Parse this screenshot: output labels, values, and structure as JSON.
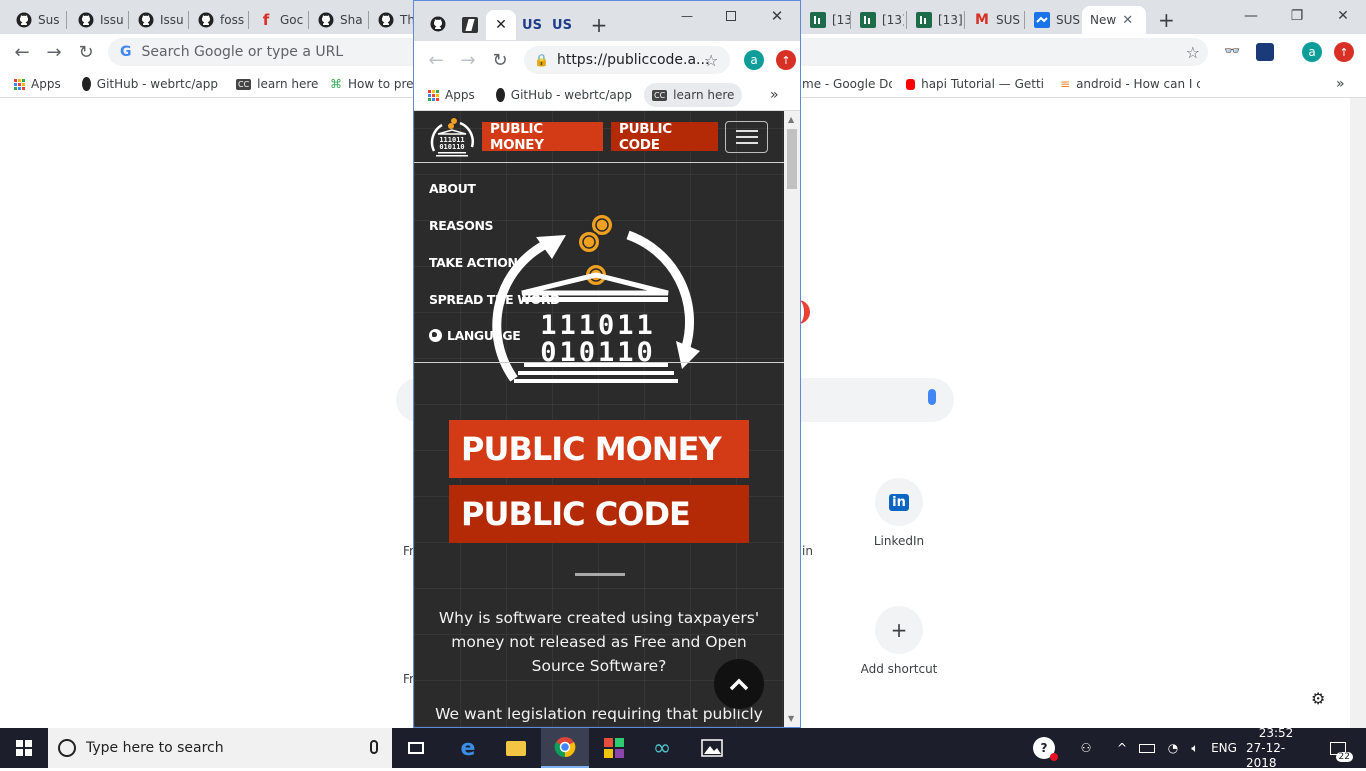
{
  "colors": {
    "accent_red": "#d23b16",
    "accent_red_dark": "#b52a06",
    "orange_coin": "#f0a020"
  },
  "background_window": {
    "tabs": [
      {
        "label": "Sus",
        "icon": "github-icon"
      },
      {
        "label": "Issu",
        "icon": "github-icon"
      },
      {
        "label": "Issu",
        "icon": "github-icon"
      },
      {
        "label": "foss",
        "icon": "github-icon"
      },
      {
        "label": "Goc",
        "icon": "f-icon"
      },
      {
        "label": "Sha",
        "icon": "github-icon"
      },
      {
        "label": "Th",
        "icon": "github-icon"
      },
      {
        "label": "[13]",
        "icon": "chart-icon"
      },
      {
        "label": "[13]",
        "icon": "chart-icon"
      },
      {
        "label": "[13]",
        "icon": "chart-icon"
      },
      {
        "label": "SUS",
        "icon": "gmail-icon"
      },
      {
        "label": "SUS",
        "icon": "docs-icon"
      },
      {
        "label": "New",
        "icon": "none"
      }
    ],
    "omnibox_placeholder": "Search Google or type a URL",
    "bookmarks": [
      {
        "label": "Apps"
      },
      {
        "label": "GitHub - webrtc/app"
      },
      {
        "label": "learn here"
      },
      {
        "label": "How to pre"
      },
      {
        "label": "me - Google Do"
      },
      {
        "label": "hapi Tutorial — Getti"
      },
      {
        "label": "android - How can I c"
      }
    ],
    "shortcuts": [
      {
        "label": "LinkedIn"
      },
      {
        "label": "Add shortcut"
      },
      {
        "label": "Fr"
      },
      {
        "label": "Fr"
      },
      {
        "label": "in"
      }
    ]
  },
  "popup_window": {
    "tabs": [
      {
        "icon": "github-icon"
      },
      {
        "icon": "bookmark-icon"
      },
      {
        "icon": "close-icon"
      },
      {
        "label": "US",
        "icon": "us-icon"
      },
      {
        "label": "US",
        "icon": "us-icon"
      },
      {
        "icon": "new-tab-icon"
      }
    ],
    "url": "https://publiccode.a...",
    "avatar_letter": "a",
    "bookmarks": [
      {
        "label": "Apps"
      },
      {
        "label": "GitHub - webrtc/app"
      },
      {
        "label": "learn here"
      }
    ],
    "site": {
      "logo_line1": "111011",
      "logo_line2": "010110",
      "nav_buttons": [
        {
          "label": "PUBLIC MONEY"
        },
        {
          "label": "PUBLIC CODE"
        }
      ],
      "menu": [
        {
          "label": "ABOUT"
        },
        {
          "label": "REASONS"
        },
        {
          "label": "TAKE ACTION"
        },
        {
          "label": "SPREAD THE WORD"
        },
        {
          "label": "LANGUAGE"
        }
      ],
      "hero_line1": "111011",
      "hero_line2": "010110",
      "title_line1": "PUBLIC MONEY",
      "title_line2": "PUBLIC CODE",
      "paragraph1": "Why is software created using taxpayers' money not released as Free and Open Source Software?",
      "paragraph2": "We want legislation requiring that publicly"
    }
  },
  "taskbar": {
    "search_placeholder": "Type here to search",
    "language": "ENG",
    "time": "23:52",
    "date": "27-12-2018",
    "notification_count": "22"
  }
}
